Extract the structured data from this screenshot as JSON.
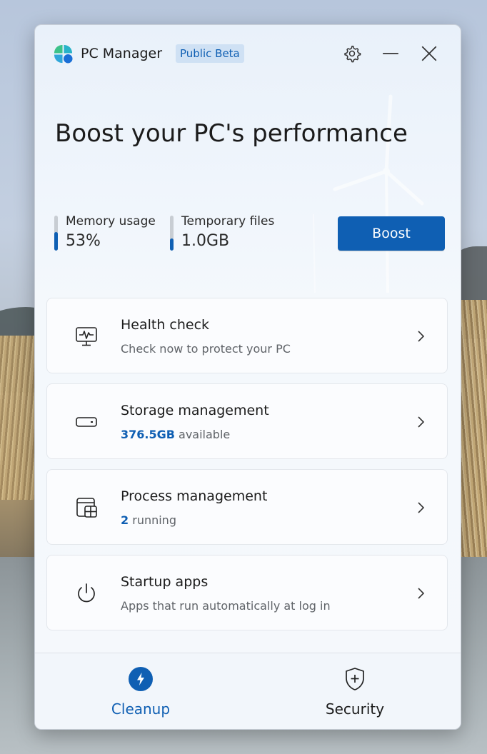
{
  "window": {
    "app_title": "PC Manager",
    "badge": "Public Beta"
  },
  "hero": {
    "headline": "Boost your PC's performance"
  },
  "stats": {
    "memory": {
      "label": "Memory usage",
      "value": "53%",
      "fill": 0.53
    },
    "temp": {
      "label": "Temporary files",
      "value": "1.0GB",
      "fill": 0.35
    }
  },
  "boost_label": "Boost",
  "cards": [
    {
      "title": "Health check",
      "subtitle": "Check now to protect your PC",
      "accent": "",
      "icon": "monitor-pulse-icon"
    },
    {
      "title": "Storage management",
      "subtitle": "available",
      "accent": "376.5GB",
      "icon": "hard-drive-icon"
    },
    {
      "title": "Process management",
      "subtitle": "running",
      "accent": "2",
      "icon": "process-windows-icon"
    },
    {
      "title": "Startup apps",
      "subtitle": "Apps that run automatically at log in",
      "accent": "",
      "icon": "power-icon"
    }
  ],
  "nav": {
    "cleanup": "Cleanup",
    "security": "Security"
  },
  "colors": {
    "accent": "#0f5fb3",
    "badge_bg": "#cfe1f4"
  },
  "icons": {
    "logo": "pc-manager-logo-icon",
    "settings": "gear-icon",
    "minimize": "minimize-icon",
    "close": "close-icon",
    "chevron": "chevron-right-icon",
    "cleanup": "lightning-icon",
    "security": "shield-plus-icon"
  }
}
